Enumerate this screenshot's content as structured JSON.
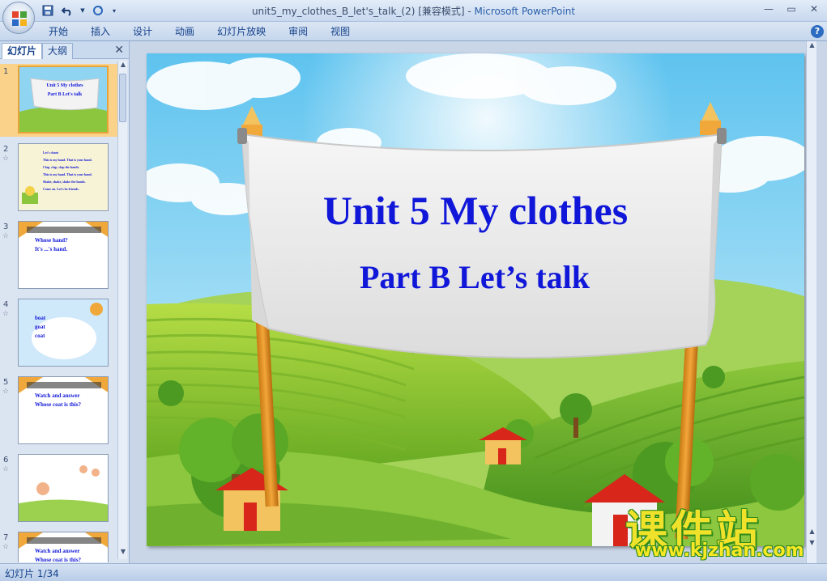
{
  "window": {
    "title_doc": "unit5_my_clothes_B_let's_talk_(2) [兼容模式] - ",
    "title_app": "Microsoft PowerPoint",
    "minimize": "—",
    "restore": "▭",
    "close": "✕"
  },
  "ribbon": {
    "tabs": [
      "开始",
      "插入",
      "设计",
      "动画",
      "幻灯片放映",
      "审阅",
      "视图"
    ],
    "help": "?"
  },
  "panel": {
    "tab_slides": "幻灯片",
    "tab_outline": "大纲",
    "close": "✕",
    "thumbnails": [
      {
        "num": "1",
        "lines": [
          "Unit 5 My clothes",
          "Part B Let's talk"
        ]
      },
      {
        "num": "2",
        "lines": [
          "Let's chant",
          "This is my hand. That is your hand.",
          "Clap, clap, clap the hands.",
          "This is my hand. That is your hand.",
          "Shake, shake, shake the hands.",
          "Come on. Let's be friends."
        ]
      },
      {
        "num": "3",
        "lines": [
          "Whose hand?",
          "It's ...'s hand."
        ]
      },
      {
        "num": "4",
        "lines": [
          "boat",
          "goat",
          "coat"
        ]
      },
      {
        "num": "5",
        "lines": [
          "Watch and answer",
          "Whose coat is this?"
        ]
      },
      {
        "num": "6",
        "lines": []
      },
      {
        "num": "7",
        "lines": [
          "Watch and answer",
          "Whose coat is this?"
        ]
      }
    ]
  },
  "slide": {
    "title": "Unit 5 My clothes",
    "subtitle": "Part B Let’s talk"
  },
  "watermark": {
    "cn": "课件站",
    "url": "www.kjzhan.com"
  },
  "status": {
    "slide_count": "幻灯片 1/34"
  },
  "colors": {
    "title_blue": "#1017d8",
    "sky": "#7fcff2",
    "grass": "#8cc63a",
    "selection": "#fbd28a"
  }
}
